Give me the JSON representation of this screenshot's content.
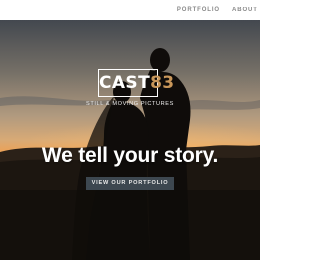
{
  "nav": {
    "items": [
      "PORTFOLIO",
      "ABOUT US"
    ]
  },
  "hero": {
    "logo": {
      "main": "CAST",
      "accent": "83"
    },
    "tagline": "STILL & MOVING PICTURES",
    "headline": "We tell your story.",
    "cta_label": "VIEW OUR PORTFOLIO"
  },
  "colors": {
    "logo_accent": "#c9975a",
    "cta_background": "#3d4750",
    "sunset_glow": "#f0a050"
  },
  "icons": []
}
